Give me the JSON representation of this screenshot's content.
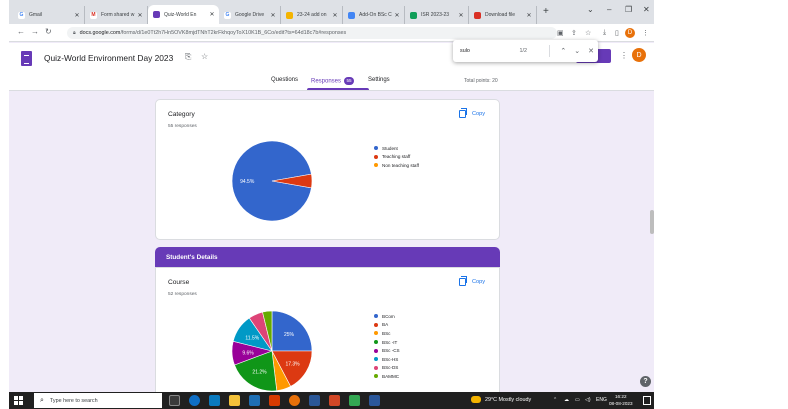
{
  "tabs": [
    {
      "label": "Gmail",
      "favicon_color": "#ffffff",
      "favicon_text": "G",
      "favicon_text_color": "#4285f4"
    },
    {
      "label": "Form shared w",
      "favicon_color": "#ffffff",
      "favicon_text": "M",
      "favicon_text_color": "#d93025"
    },
    {
      "label": "Quiz-World En",
      "favicon_color": "#673ab7",
      "favicon_text": "",
      "favicon_text_color": "#ffffff",
      "active": true
    },
    {
      "label": "Google Drive",
      "favicon_color": "#ffffff",
      "favicon_text": "G",
      "favicon_text_color": "#4285f4"
    },
    {
      "label": "23-24 add on",
      "favicon_color": "#f4b400",
      "favicon_text": "",
      "favicon_text_color": "#ffffff"
    },
    {
      "label": "Add-On BSc C",
      "favicon_color": "#4285f4",
      "favicon_text": "",
      "favicon_text_color": "#ffffff"
    },
    {
      "label": "ISR 2023-23",
      "favicon_color": "#0f9d58",
      "favicon_text": "",
      "favicon_text_color": "#ffffff"
    },
    {
      "label": "Download file",
      "favicon_color": "#d93025",
      "favicon_text": "",
      "favicon_text_color": "#ffffff"
    }
  ],
  "address_bar": {
    "url_host": "docs.google.com",
    "url_path": "/forms/d/1e0Tt2h7Hn5OVK8mjdTNhT2krFkhqoyToX10K1B_6Co/edit?ts=64d18c7b#responses"
  },
  "find_bar": {
    "query": "sulo",
    "count": "1/2"
  },
  "form": {
    "title": "Quiz-World Environment Day 2023",
    "avatar_letter": "D",
    "tabs": {
      "questions": "Questions",
      "responses": "Responses",
      "responses_count": "55",
      "settings": "Settings"
    },
    "total_points": "Total points: 20"
  },
  "cards": {
    "category": {
      "title": "Category",
      "responses": "55 responses",
      "copy": "Copy"
    },
    "section_header": "Student's Details",
    "course": {
      "title": "Course",
      "responses": "52 responses",
      "copy": "Copy"
    }
  },
  "chart_data": [
    {
      "type": "pie",
      "title": "Category",
      "labels": [
        "Student",
        "Teaching staff",
        "Non teaching staff"
      ],
      "colors": [
        "#3366cc",
        "#dc3912",
        "#ff9900"
      ],
      "values": [
        94.5,
        5.5,
        0
      ],
      "slice_labels": [
        "94.5%",
        "",
        ""
      ]
    },
    {
      "type": "pie",
      "title": "Course",
      "labels": [
        "BCom",
        "BA",
        "BSc",
        "BSc -IT",
        "BSc -CS",
        "BSc-HS",
        "BSc-DS",
        "BAMMC"
      ],
      "colors": [
        "#3366cc",
        "#dc3912",
        "#ff9900",
        "#109618",
        "#990099",
        "#0099c6",
        "#dd4477",
        "#66aa00"
      ],
      "values": [
        25,
        17.3,
        5.8,
        21.2,
        9.6,
        11.5,
        5.8,
        3.8
      ],
      "slice_labels": [
        "25%",
        "17.3%",
        "",
        "21.2%",
        "9.6%",
        "11.5%",
        "",
        ""
      ]
    }
  ],
  "taskbar": {
    "search_placeholder": "Type here to search",
    "weather": "29°C  Mostly cloudy",
    "language": "ENG",
    "time": "16:22",
    "date": "08-08-2023"
  }
}
